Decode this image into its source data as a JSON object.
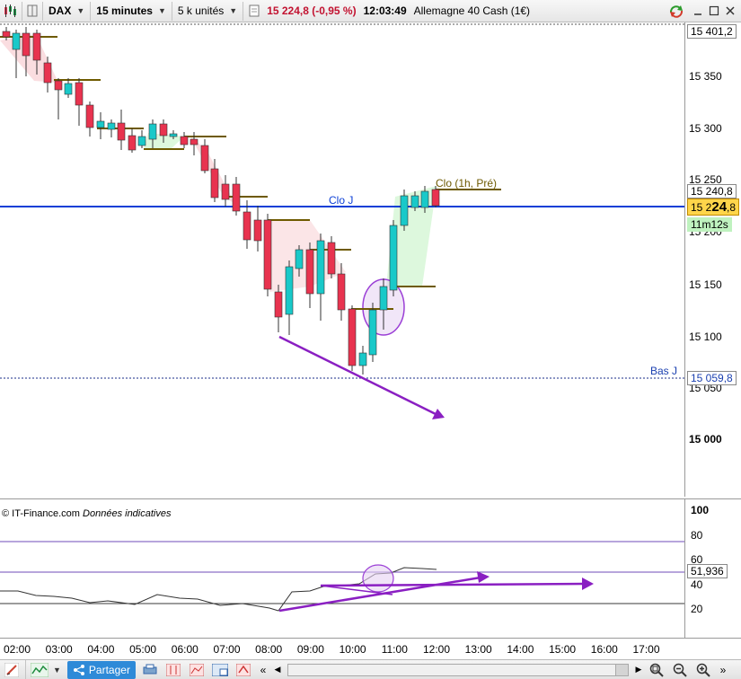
{
  "toolbar": {
    "symbol": "DAX",
    "timeframe": "15 minutes",
    "units": "5 k unités",
    "price_change": "15 224,8 (-0,95 %)",
    "time": "12:03:49",
    "instrument": "Allemagne 40 Cash (1€)"
  },
  "price_axis": {
    "ticks": [
      "15 350",
      "15 300",
      "15 250",
      "15 200",
      "15 150",
      "15 100",
      "15 050",
      "15 000"
    ],
    "top_box": "15 401,2",
    "pre_box": "15 240,8",
    "current_box_prefix": "15 2",
    "current_box_main": "24",
    "current_box_suffix": ",8",
    "countdown": "11m12s",
    "low_box": "15 059,8"
  },
  "annotations": {
    "clo_j": "Clo J",
    "clo_1h": "Clo (1h, Pré)",
    "bas_j": "Bas J"
  },
  "copyright": {
    "source": "© IT-Finance.com",
    "note": "Données indicatives"
  },
  "osc_axis": {
    "ticks": [
      "100",
      "80",
      "60",
      "40",
      "20"
    ],
    "value_box": "51,936"
  },
  "time_axis": [
    "02:00",
    "03:00",
    "04:00",
    "05:00",
    "06:00",
    "07:00",
    "08:00",
    "09:00",
    "10:00",
    "11:00",
    "12:00",
    "13:00",
    "14:00",
    "15:00",
    "16:00",
    "17:00"
  ],
  "bottombar": {
    "share_label": "Partager"
  },
  "colors": {
    "up": "#19c9c9",
    "down": "#e8334f",
    "clo_line": "#0b3fd6",
    "level": "#6e5a00",
    "arrow": "#8a1fc2",
    "osc_lines": "#6f4bb8"
  }
}
